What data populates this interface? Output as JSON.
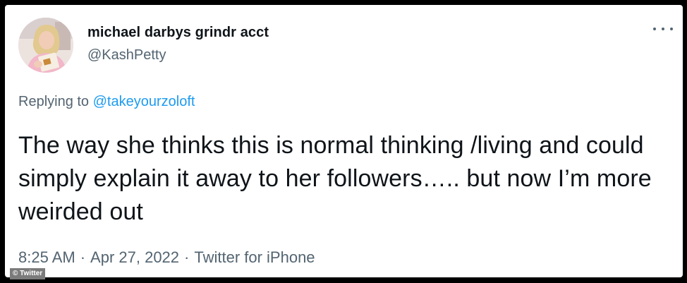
{
  "tweet": {
    "display_name": "michael darbys grindr acct",
    "handle": "@KashPetty",
    "replying_prefix": "Replying to",
    "replying_to": "@takeyourzoloft",
    "text": "The way she thinks this is normal thinking /living and could simply explain it away to her followers….. but now I’m more weirded out",
    "time": "8:25 AM",
    "separator_1": "·",
    "date": "Apr 27, 2022",
    "separator_2": "·",
    "source": "Twitter for iPhone",
    "more_icon": "more-horizontal-icon"
  },
  "credit": {
    "label": "© Twitter"
  },
  "colors": {
    "background": "#000000",
    "card": "#ffffff",
    "primary_text": "#0f1419",
    "secondary_text": "#536471",
    "link": "#1d9bf0"
  }
}
